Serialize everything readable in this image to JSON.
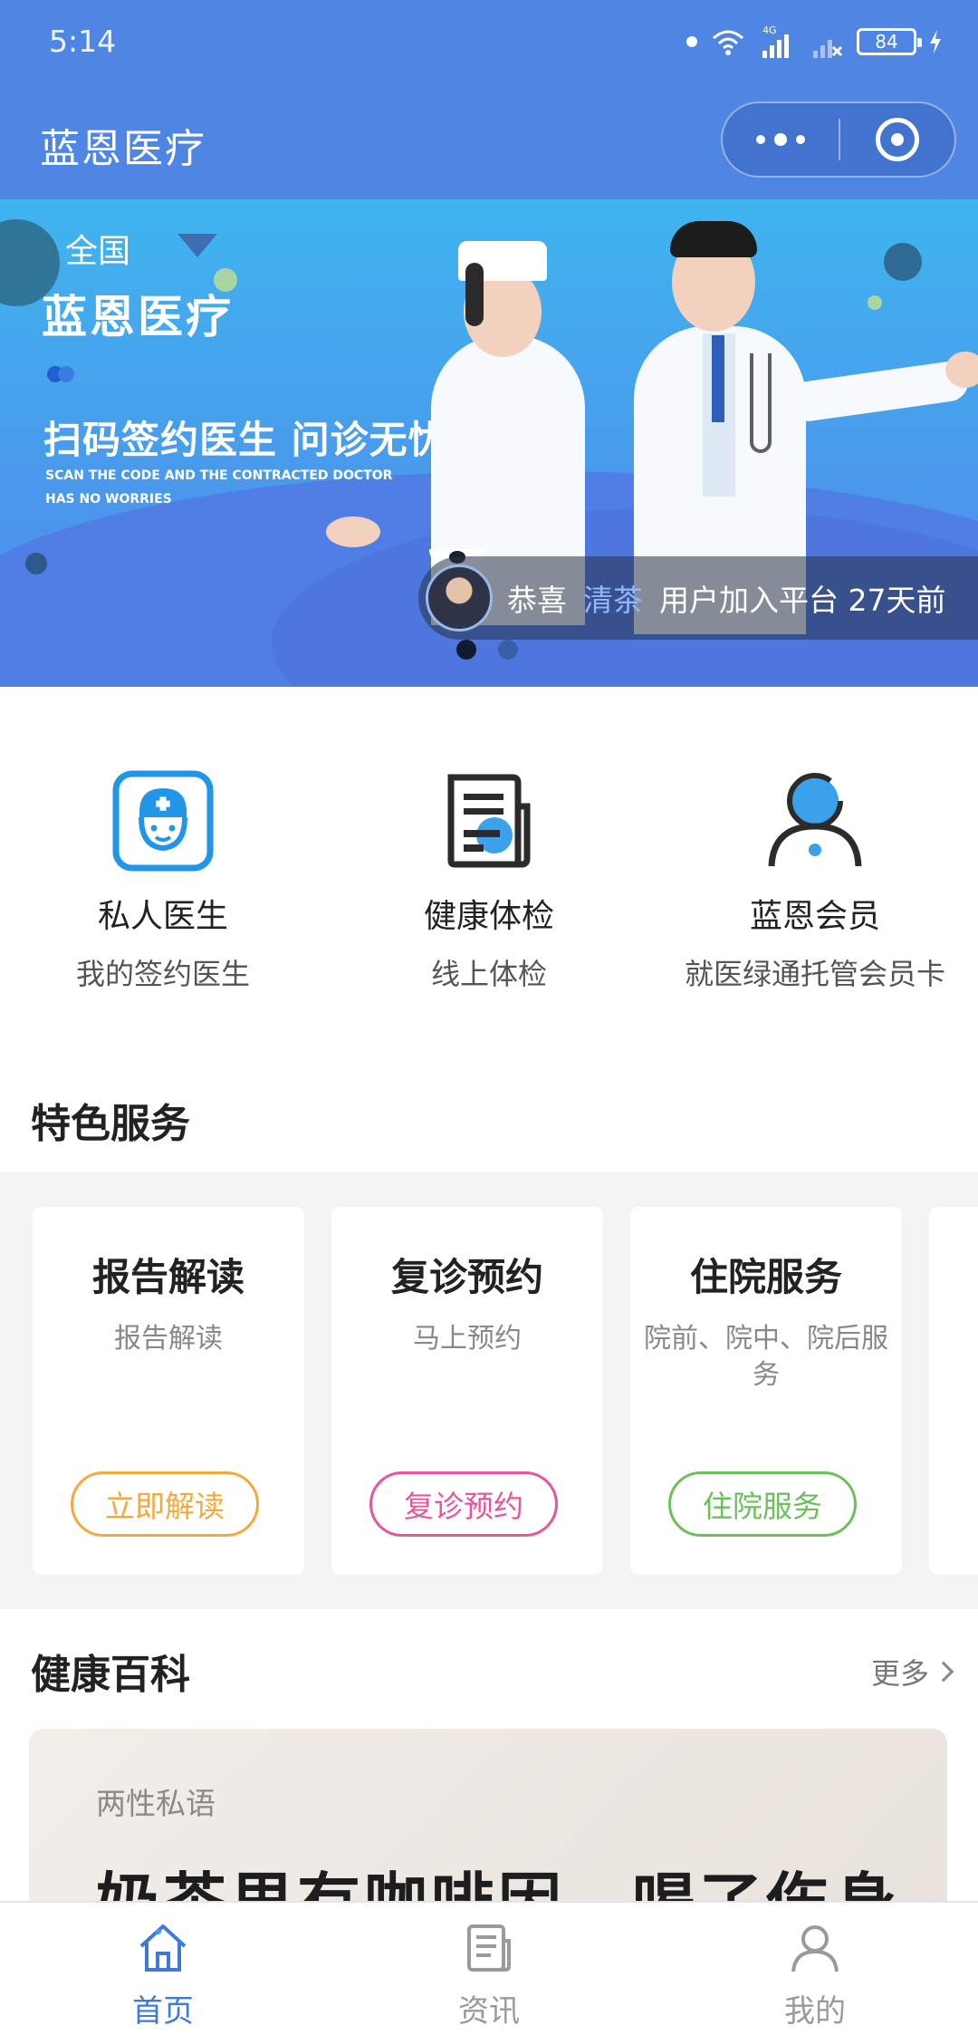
{
  "status_bar": {
    "time": "5:14",
    "network": "4G",
    "battery": "84"
  },
  "header": {
    "title": "蓝恩医疗",
    "more_icon": "more-dots-icon",
    "close_icon": "target-icon"
  },
  "banner": {
    "region": "全国",
    "brand": "蓝恩医疗",
    "slogan": "扫码签约医生 问诊无忧",
    "slogan_en_line1": "SCAN THE CODE AND THE CONTRACTED DOCTOR",
    "slogan_en_line2": "HAS NO WORRIES",
    "notice": {
      "prefix": "恭喜",
      "user": "清茶",
      "suffix": "用户加入平台 27天前"
    },
    "pager": {
      "count": 2,
      "active": 1
    }
  },
  "quick_entries": [
    {
      "title": "私人医生",
      "subtitle": "我的签约医生",
      "icon": "doctor-icon"
    },
    {
      "title": "健康体检",
      "subtitle": "线上体检",
      "icon": "document-icon"
    },
    {
      "title": "蓝恩会员",
      "subtitle": "就医绿通托管会员卡",
      "icon": "member-icon"
    }
  ],
  "featured": {
    "section_title": "特色服务",
    "cards": [
      {
        "title": "报告解读",
        "subtitle": "报告解读",
        "button": "立即解读",
        "color": "#f5a93c"
      },
      {
        "title": "复诊预约",
        "subtitle": "马上预约",
        "button": "复诊预约",
        "color": "#e8559a"
      },
      {
        "title": "住院服务",
        "subtitle": "院前、院中、院后服务",
        "button": "住院服务",
        "color": "#6cbf5a"
      }
    ]
  },
  "wiki": {
    "section_title": "健康百科",
    "more": "更多",
    "article": {
      "category": "两性私语",
      "headline": "奶茶里有咖啡因，喝了伤身"
    }
  },
  "tabbar": {
    "tabs": [
      {
        "label": "首页",
        "icon": "home-icon",
        "active": true
      },
      {
        "label": "资讯",
        "icon": "news-icon",
        "active": false
      },
      {
        "label": "我的",
        "icon": "profile-icon",
        "active": false
      }
    ]
  },
  "colors": {
    "primary": "#4f86e3",
    "active_tab": "#3f7ad8",
    "inactive_tab": "#9a9a9a",
    "notice_highlight": "#8fb6ff"
  }
}
